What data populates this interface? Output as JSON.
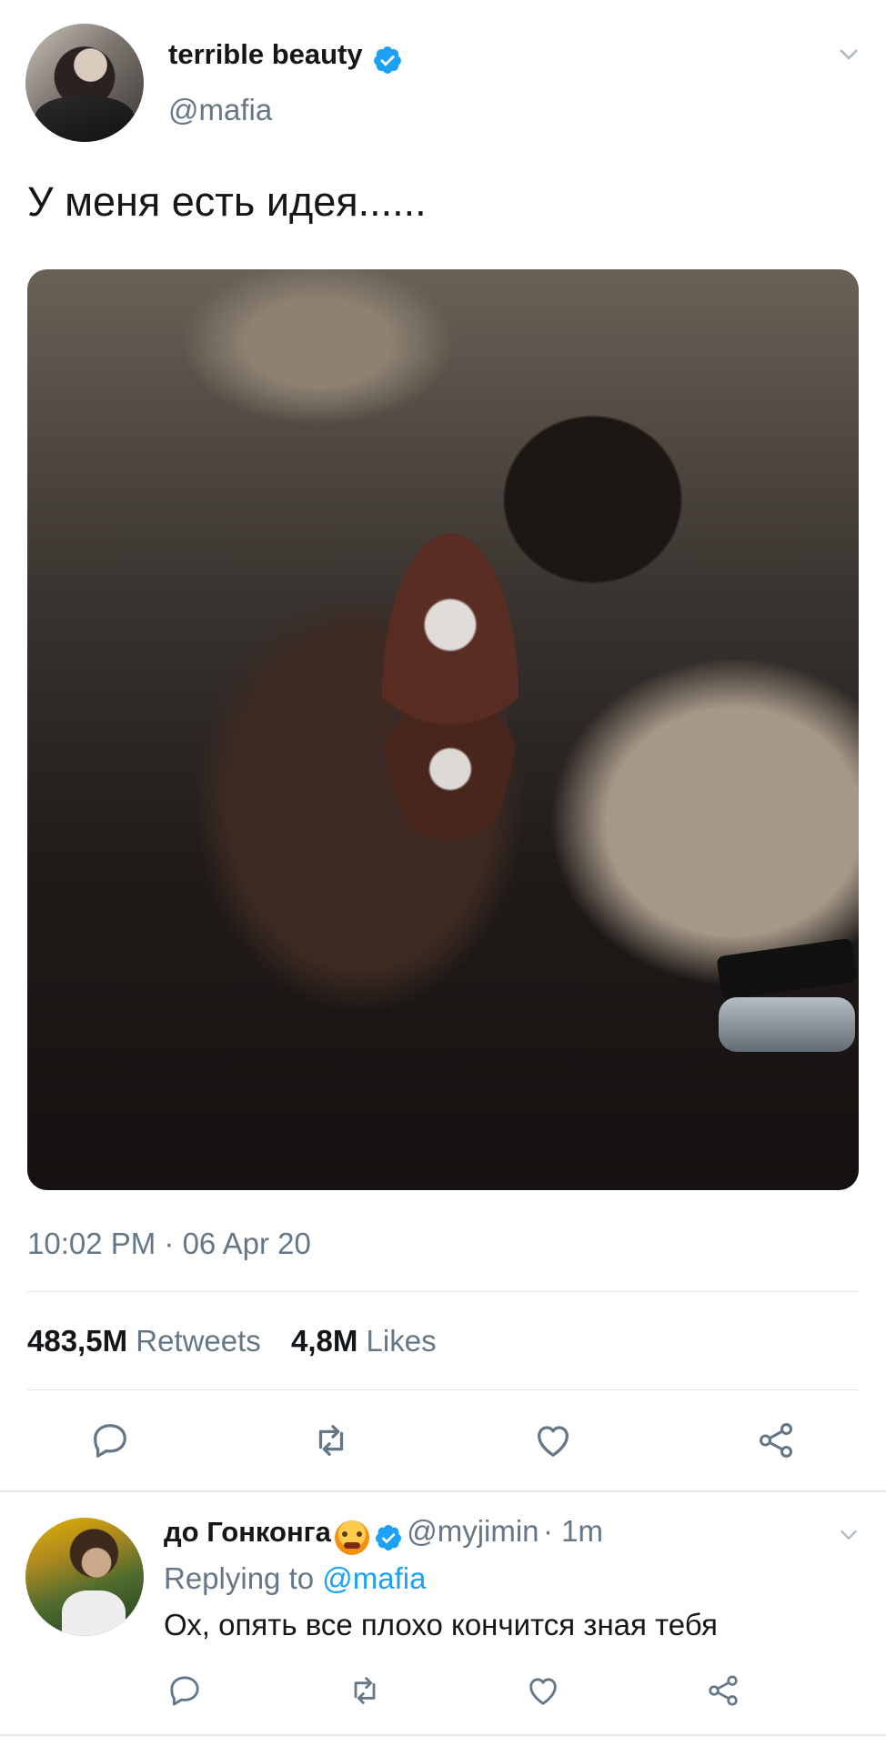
{
  "tweet": {
    "display_name": "terrible beauty",
    "handle": "@mafia",
    "text": "У меня есть идея......",
    "timestamp": "10:02 PM · 06 Apr 20",
    "retweets_count": "483,5M",
    "retweets_label": "Retweets",
    "likes_count": "4,8M",
    "likes_label": "Likes"
  },
  "reply": {
    "display_name": "до Гонконга",
    "handle": "@myjimin",
    "time": "· 1m",
    "replying_prefix": "Replying to",
    "replying_to": "@mafia",
    "text": "Ох, опять все плохо кончится зная тебя"
  },
  "icons": {
    "verified": "verified-badge-icon",
    "menu": "chevron-down-icon",
    "reply": "reply-icon",
    "retweet": "retweet-icon",
    "like": "heart-icon",
    "share": "share-icon"
  },
  "colors": {
    "twitter_blue": "#1da1f2",
    "muted": "#657786",
    "icon_gray": "#657786",
    "divider": "#e1e8ed"
  }
}
